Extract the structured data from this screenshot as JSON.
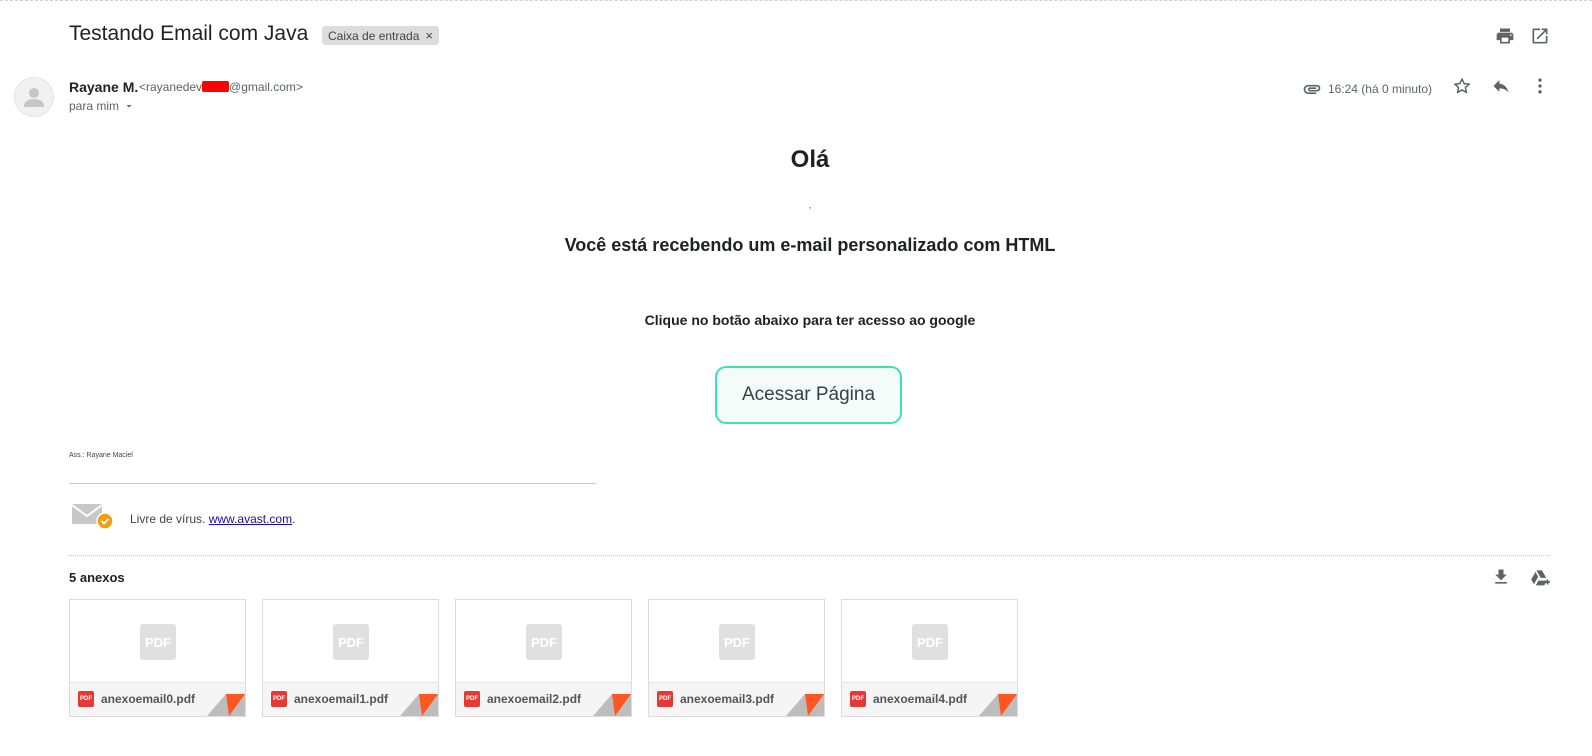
{
  "header": {
    "subject": "Testando Email com Java",
    "label": "Caixa de entrada",
    "label_remove": "×",
    "icons": [
      "print-icon",
      "open-in-new-window-icon"
    ]
  },
  "sender": {
    "name": "Rayane M.",
    "email_prefix": "<rayanedev",
    "email_suffix": "@gmail.com>",
    "to": "para mim",
    "time": "16:24 (há 0 minuto)",
    "icons": [
      "attachment-icon",
      "star-icon",
      "reply-icon",
      "more-vert-icon"
    ]
  },
  "body": {
    "greeting": "Olá",
    "comma": ",",
    "headline": "Você está recebendo um e-mail personalizado com HTML",
    "instruction": "Clique no botão abaixo para ter acesso ao google",
    "button": "Acessar Página",
    "signature": "Ass.: Rayane Maciel",
    "avast_text": "Livre de vírus.",
    "avast_link": "www.avast.com",
    "avast_period": "."
  },
  "attachments": {
    "title": "5 anexos",
    "thumb_label": "PDF",
    "badge_label": "PDF",
    "files": [
      {
        "name": "anexoemail0.pdf"
      },
      {
        "name": "anexoemail1.pdf"
      },
      {
        "name": "anexoemail2.pdf"
      },
      {
        "name": "anexoemail3.pdf"
      },
      {
        "name": "anexoemail4.pdf"
      }
    ]
  },
  "colors": {
    "button_border": "#3fe0b2",
    "button_bg": "#f3fcf9",
    "pdf_red": "#e53935",
    "link": "#1a0dab",
    "redaction": "#ff0000"
  }
}
